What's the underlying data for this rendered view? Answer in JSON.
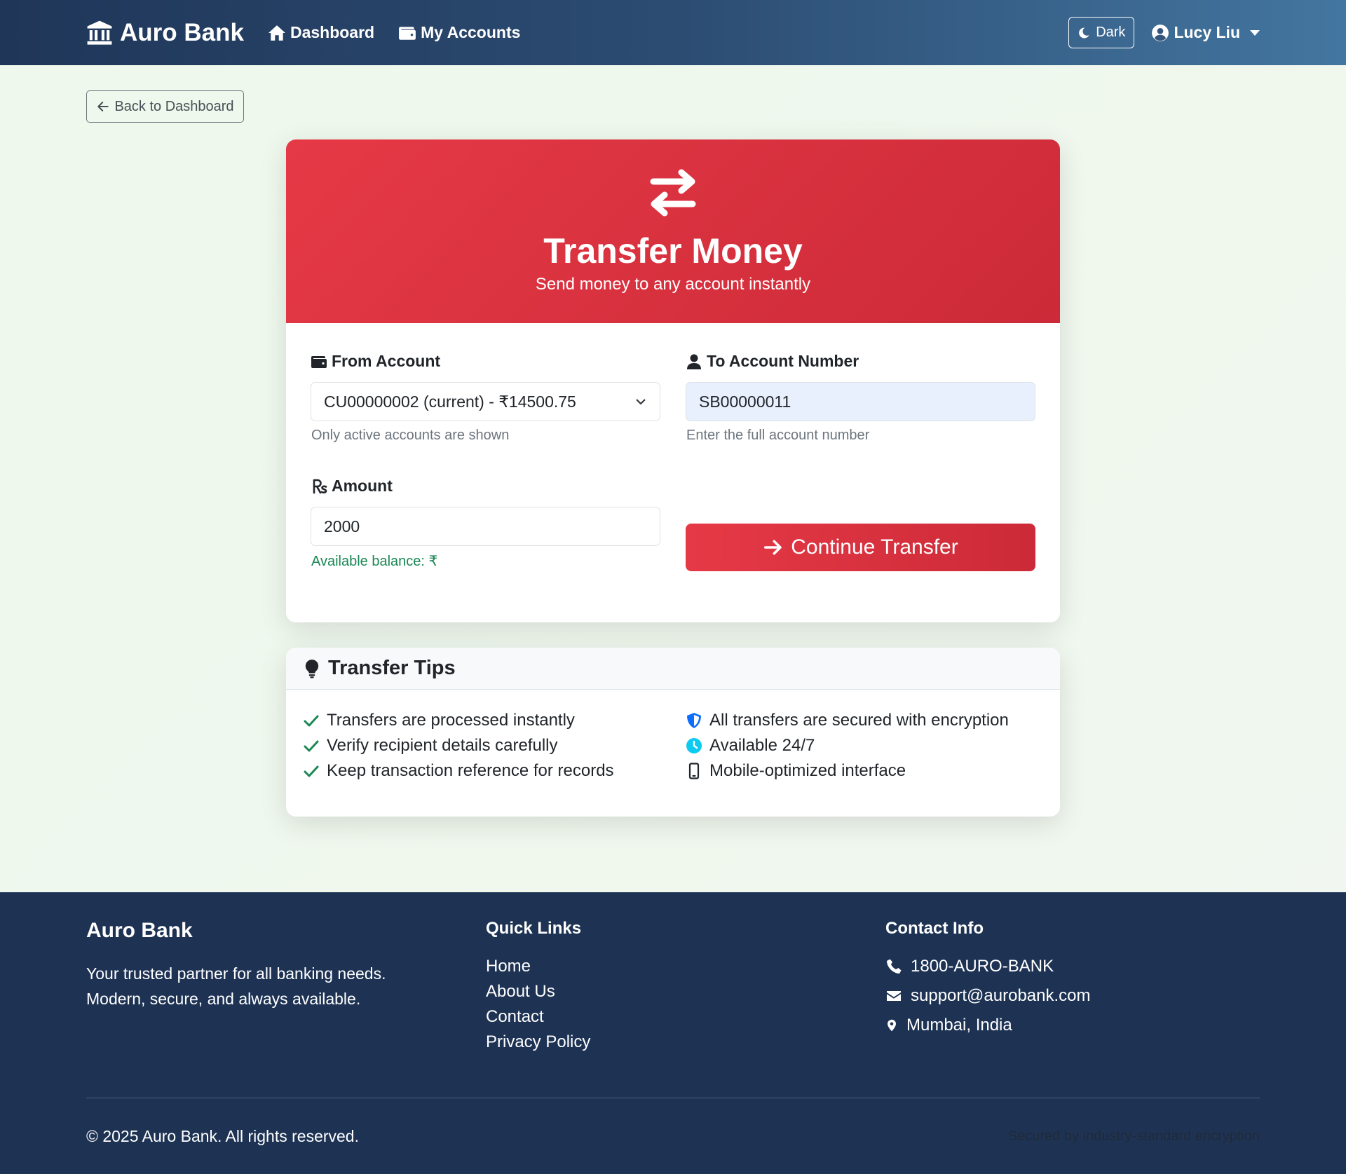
{
  "navbar": {
    "brand": "Auro Bank",
    "links": [
      {
        "label": "Dashboard",
        "icon": "home-icon"
      },
      {
        "label": "My Accounts",
        "icon": "wallet-icon"
      }
    ],
    "theme_toggle": "Dark",
    "user_name": "Lucy Liu"
  },
  "back_button": "Back to Dashboard",
  "transfer": {
    "title": "Transfer Money",
    "subtitle": "Send money to any account instantly",
    "from_label": "From Account",
    "from_value": "CU00000002 (current) - ₹14500.75",
    "from_help": "Only active accounts are shown",
    "to_label": "To Account Number",
    "to_value": "SB00000011",
    "to_help": "Enter the full account number",
    "amount_label": "Amount",
    "amount_value": "2000",
    "balance_text": "Available balance: ₹",
    "submit_label": "Continue Transfer"
  },
  "tips": {
    "title": "Transfer Tips",
    "left": [
      "Transfers are processed instantly",
      "Verify recipient details carefully",
      "Keep transaction reference for records"
    ],
    "right": [
      {
        "text": "All transfers are secured with encryption",
        "icon": "shield-icon"
      },
      {
        "text": "Available 24/7",
        "icon": "clock-icon"
      },
      {
        "text": "Mobile-optimized interface",
        "icon": "mobile-icon"
      }
    ]
  },
  "footer": {
    "brand": "Auro Bank",
    "tagline": "Your trusted partner for all banking needs. Modern, secure, and always available.",
    "quick_links_title": "Quick Links",
    "quick_links": [
      "Home",
      "About Us",
      "Contact",
      "Privacy Policy"
    ],
    "contact_title": "Contact Info",
    "phone": "1800-AURO-BANK",
    "email": "support@aurobank.com",
    "location": "Mumbai, India",
    "copyright": "© 2025 Auro Bank. All rights reserved.",
    "security_note": "Secured by industry-standard encryption"
  },
  "colors": {
    "brand_red": "#e63946",
    "navbar": "#1f3658",
    "footer": "#1e3354",
    "success": "#198754"
  }
}
